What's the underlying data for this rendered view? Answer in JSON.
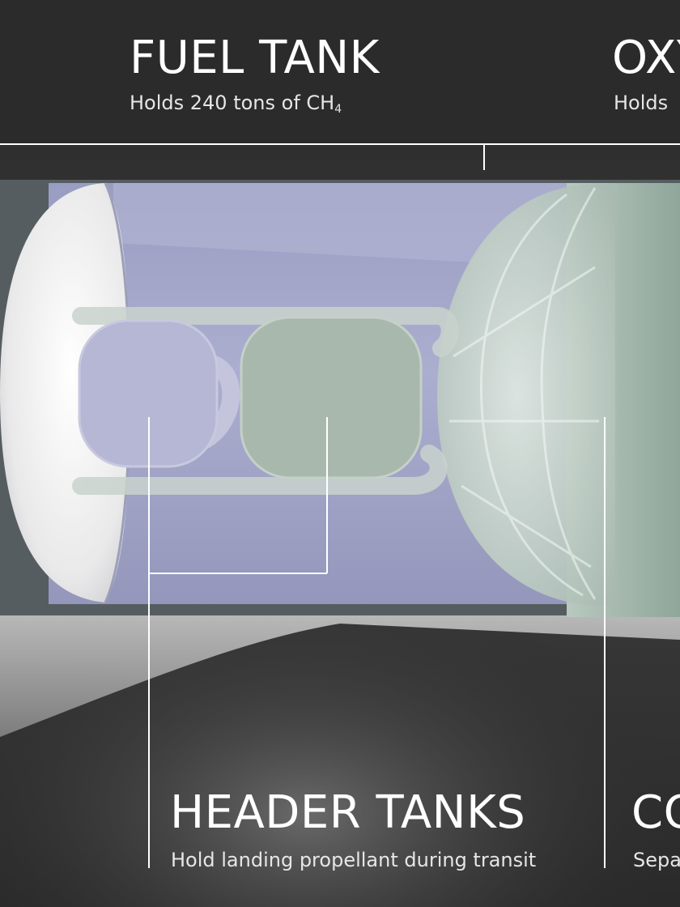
{
  "callouts": {
    "fuel_tank": {
      "title": "FUEL TANK",
      "desc_prefix": "Holds 240 tons of CH",
      "desc_subscript": "4"
    },
    "oxygen_tank": {
      "title": "OXY",
      "desc": "Holds"
    },
    "header_tanks": {
      "title": "HEADER TANKS",
      "desc": "Hold landing propellant during transit"
    },
    "common_dome": {
      "title": "CO",
      "desc": "Sepa"
    }
  },
  "colors": {
    "background": "#2a2a2a",
    "fuel_tank_fill": "#a6a9c9",
    "oxygen_tank_fill": "#9fb3a8",
    "dome_white": "#eeeeee",
    "leader_line": "#ffffff"
  }
}
